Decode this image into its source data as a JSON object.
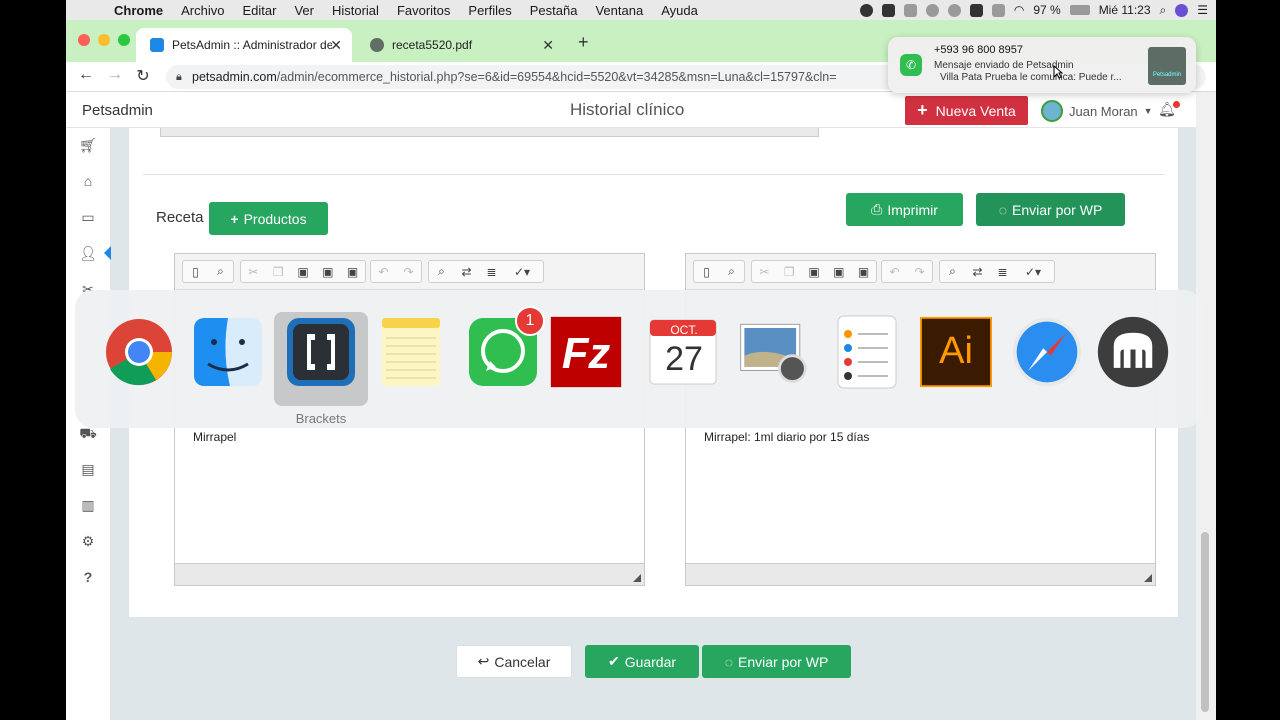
{
  "menubar": {
    "app": "Chrome",
    "items": [
      "Archivo",
      "Editar",
      "Ver",
      "Historial",
      "Favoritos",
      "Perfiles",
      "Pestaña",
      "Ventana",
      "Ayuda"
    ],
    "battery": "97 %",
    "clock": "Mié 11:23"
  },
  "browser": {
    "tabs": [
      {
        "title": "PetsAdmin :: Administrador de"
      },
      {
        "title": "receta5520.pdf"
      }
    ],
    "url_host": "petsadmin.com",
    "url_path": "/admin/ecommerce_historial.php?se=6&id=69554&hcid=5520&vt=34285&msn=Luna&cl=15797&cln="
  },
  "notification": {
    "sender": "+593 96 800 8957",
    "line1": "Mensaje enviado de Petsadmin",
    "line2": "Villa Pata Prueba le comunica:  Puede r...",
    "thumb_label": "Petsadmin"
  },
  "header": {
    "logo": "Petsadmin",
    "title": "Historial clínico",
    "new_sale": "Nueva Venta",
    "user": "Juan Moran"
  },
  "receta": {
    "label": "Receta",
    "productos": "Productos",
    "imprimir": "Imprimir",
    "enviar_wp": "Enviar por WP",
    "left_editor_text": "Mirrapel",
    "right_editor_text": "Mirrapel: 1ml diario por 15 días"
  },
  "dock": {
    "selected_label": "Brackets",
    "whatsapp_badge": "1",
    "calendar_month": "OCT.",
    "calendar_day": "27",
    "illustrator": "Ai"
  },
  "footer": {
    "cancelar": "Cancelar",
    "guardar": "Guardar",
    "enviar_wp": "Enviar por WP"
  }
}
